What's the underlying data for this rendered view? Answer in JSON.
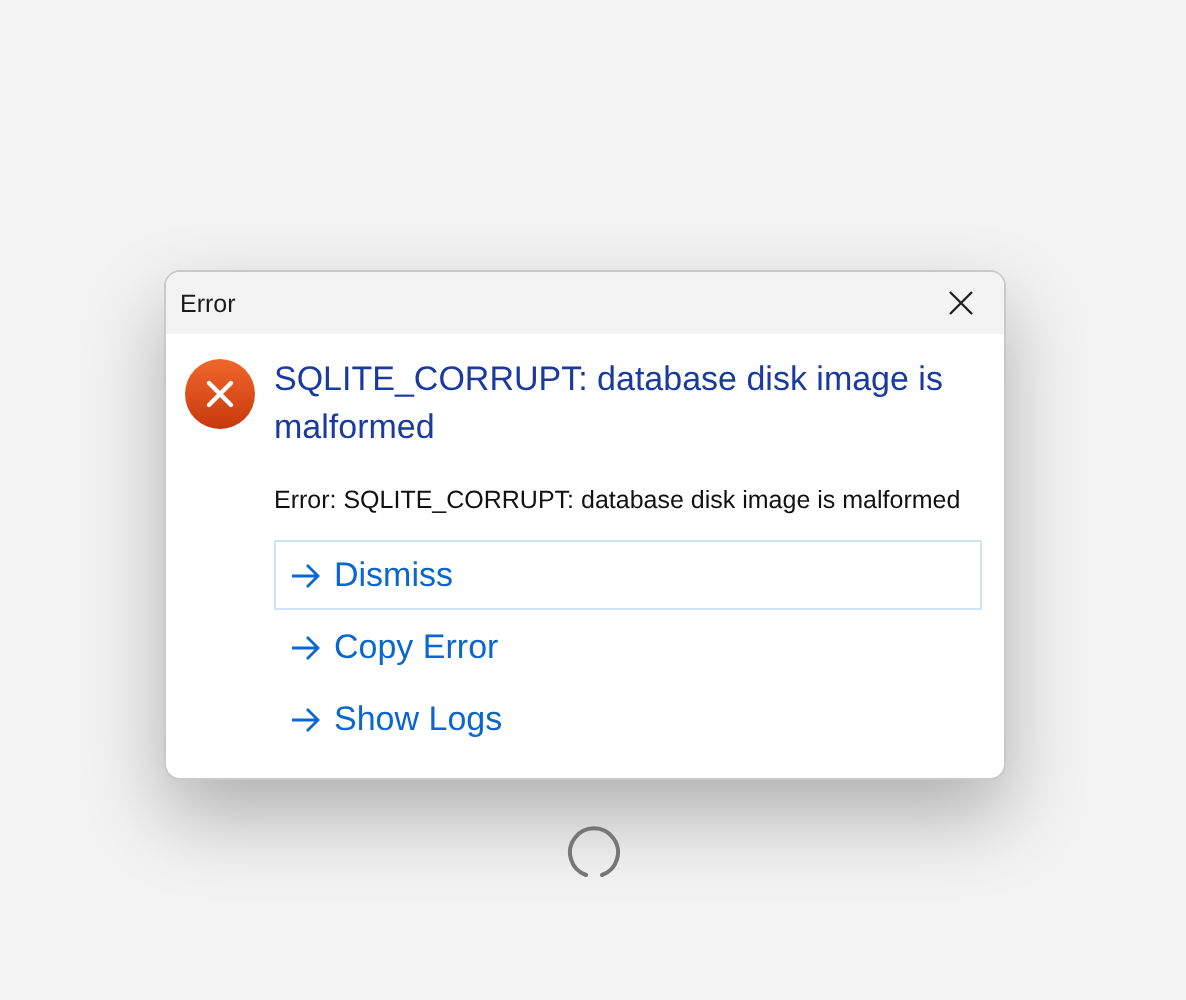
{
  "dialog": {
    "title": "Error",
    "heading": "SQLITE_CORRUPT: database disk image is malformed",
    "message": "Error: SQLITE_CORRUPT: database disk image is malformed",
    "commands": [
      {
        "label": "Dismiss",
        "focused": true
      },
      {
        "label": "Copy Error",
        "focused": false
      },
      {
        "label": "Show Logs",
        "focused": false
      }
    ]
  },
  "loading": true
}
